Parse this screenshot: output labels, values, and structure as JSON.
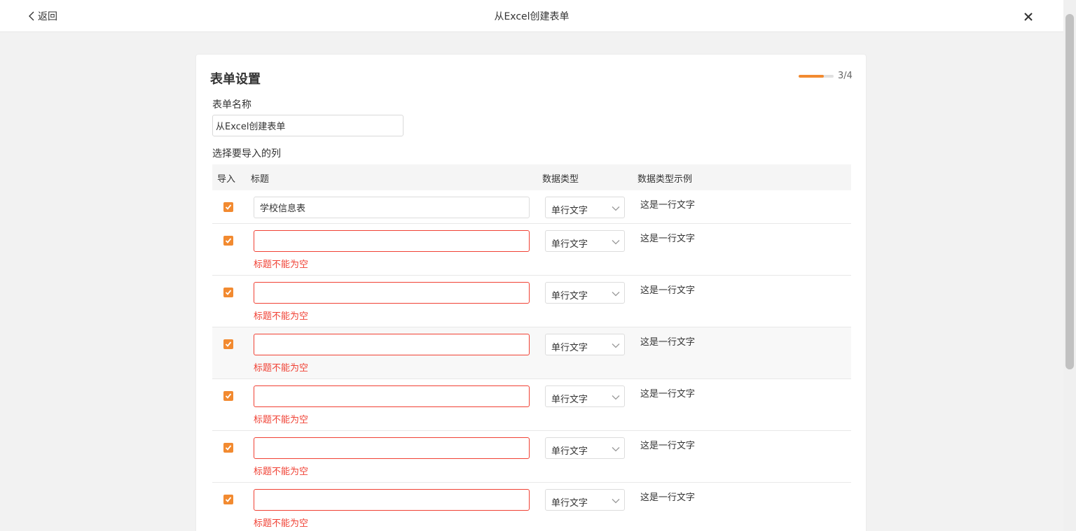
{
  "header": {
    "back_label": "返回",
    "title": "从Excel创建表单"
  },
  "card": {
    "title": "表单设置",
    "progress_text": "3/4",
    "progress_fraction": 0.72,
    "accent_color": "#f28a30",
    "error_color": "#f04134"
  },
  "form": {
    "name_label": "表单名称",
    "name_value": "从Excel创建表单",
    "columns_label": "选择要导入的列"
  },
  "table": {
    "headers": {
      "import": "导入",
      "title": "标题",
      "data_type": "数据类型",
      "example": "数据类型示例"
    },
    "rows": [
      {
        "checked": true,
        "title": "学校信息表",
        "error": "",
        "type": "单行文字",
        "example": "这是一行文字"
      },
      {
        "checked": true,
        "title": "",
        "error": "标题不能为空",
        "type": "单行文字",
        "example": "这是一行文字"
      },
      {
        "checked": true,
        "title": "",
        "error": "标题不能为空",
        "type": "单行文字",
        "example": "这是一行文字"
      },
      {
        "checked": true,
        "title": "",
        "error": "标题不能为空",
        "type": "单行文字",
        "example": "这是一行文字"
      },
      {
        "checked": true,
        "title": "",
        "error": "标题不能为空",
        "type": "单行文字",
        "example": "这是一行文字"
      },
      {
        "checked": true,
        "title": "",
        "error": "标题不能为空",
        "type": "单行文字",
        "example": "这是一行文字"
      },
      {
        "checked": true,
        "title": "",
        "error": "标题不能为空",
        "type": "单行文字",
        "example": "这是一行文字"
      }
    ]
  }
}
